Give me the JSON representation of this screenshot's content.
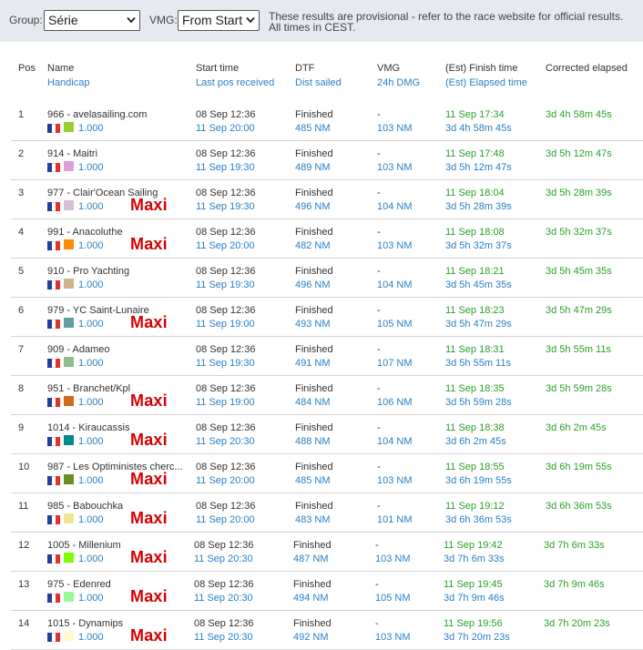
{
  "toolbar": {
    "group_label": "Group:",
    "group_value": "Série",
    "vmg_label": "VMG:",
    "vmg_value": "From Start",
    "notice_line1": "These results are provisional - refer to the race website for official results.",
    "notice_line2": "All times in CEST."
  },
  "headers": {
    "pos": "Pos",
    "name": "Name",
    "handicap": "Handicap",
    "start_time": "Start time",
    "last_pos": "Last pos received",
    "dtf": "DTF",
    "dist_sailed": "Dist sailed",
    "vmg": "VMG",
    "dmg": "24h DMG",
    "finish_time": "(Est) Finish time",
    "elapsed_time": "(Est) Elapsed time",
    "corrected": "Corrected elapsed"
  },
  "annotation_label": "Maxi",
  "rows": [
    {
      "pos": "1",
      "name": "966 - avelasailing.com",
      "handicap": "1.000",
      "swatch": "#9acd32",
      "start": "08 Sep 12:36",
      "last_pos": "11 Sep 20:00",
      "dtf": "Finished",
      "dist": "485 NM",
      "vmg": "-",
      "dmg": "103 NM",
      "finish": "11 Sep 17:34",
      "elapsed": "3d 4h 58m 45s",
      "corrected": "3d 4h 58m 45s",
      "maxi": false
    },
    {
      "pos": "2",
      "name": "914 - Maitri",
      "handicap": "1.000",
      "swatch": "#dda0dd",
      "start": "08 Sep 12:36",
      "last_pos": "11 Sep 19:30",
      "dtf": "Finished",
      "dist": "489 NM",
      "vmg": "-",
      "dmg": "103 NM",
      "finish": "11 Sep 17:48",
      "elapsed": "3d 5h 12m 47s",
      "corrected": "3d 5h 12m 47s",
      "maxi": false
    },
    {
      "pos": "3",
      "name": "977 - Clair'Ocean Sailing",
      "handicap": "1.000",
      "swatch": "#d8bfd8",
      "start": "08 Sep 12:36",
      "last_pos": "11 Sep 19:30",
      "dtf": "Finished",
      "dist": "496 NM",
      "vmg": "-",
      "dmg": "104 NM",
      "finish": "11 Sep 18:04",
      "elapsed": "3d 5h 28m 39s",
      "corrected": "3d 5h 28m 39s",
      "maxi": true
    },
    {
      "pos": "4",
      "name": "991 - Anacoluthe",
      "handicap": "1.000",
      "swatch": "#ff8c00",
      "start": "08 Sep 12:36",
      "last_pos": "11 Sep 20:00",
      "dtf": "Finished",
      "dist": "482 NM",
      "vmg": "-",
      "dmg": "103 NM",
      "finish": "11 Sep 18:08",
      "elapsed": "3d 5h 32m 37s",
      "corrected": "3d 5h 32m 37s",
      "maxi": true
    },
    {
      "pos": "5",
      "name": "910 - Pro Yachting",
      "handicap": "1.000",
      "swatch": "#d2b48c",
      "start": "08 Sep 12:36",
      "last_pos": "11 Sep 19:30",
      "dtf": "Finished",
      "dist": "496 NM",
      "vmg": "-",
      "dmg": "104 NM",
      "finish": "11 Sep 18:21",
      "elapsed": "3d 5h 45m 35s",
      "corrected": "3d 5h 45m 35s",
      "maxi": false
    },
    {
      "pos": "6",
      "name": "979 - YC Saint-Lunaire",
      "handicap": "1.000",
      "swatch": "#5f9ea0",
      "start": "08 Sep 12:36",
      "last_pos": "11 Sep 19:00",
      "dtf": "Finished",
      "dist": "493 NM",
      "vmg": "-",
      "dmg": "105 NM",
      "finish": "11 Sep 18:23",
      "elapsed": "3d 5h 47m 29s",
      "corrected": "3d 5h 47m 29s",
      "maxi": true
    },
    {
      "pos": "7",
      "name": "909 - Adameo",
      "handicap": "1.000",
      "swatch": "#8fbc8f",
      "start": "08 Sep 12:36",
      "last_pos": "11 Sep 19:30",
      "dtf": "Finished",
      "dist": "491 NM",
      "vmg": "-",
      "dmg": "107 NM",
      "finish": "11 Sep 18:31",
      "elapsed": "3d 5h 55m 11s",
      "corrected": "3d 5h 55m 11s",
      "maxi": false
    },
    {
      "pos": "8",
      "name": "951 - Branchet/Kpl",
      "handicap": "1.000",
      "swatch": "#d2691e",
      "start": "08 Sep 12:36",
      "last_pos": "11 Sep 19:00",
      "dtf": "Finished",
      "dist": "484 NM",
      "vmg": "-",
      "dmg": "106 NM",
      "finish": "11 Sep 18:35",
      "elapsed": "3d 5h 59m 28s",
      "corrected": "3d 5h 59m 28s",
      "maxi": true
    },
    {
      "pos": "9",
      "name": "1014 - Kiraucassis",
      "handicap": "1.000",
      "swatch": "#008b8b",
      "start": "08 Sep 12:36",
      "last_pos": "11 Sep 20:30",
      "dtf": "Finished",
      "dist": "488 NM",
      "vmg": "-",
      "dmg": "104 NM",
      "finish": "11 Sep 18:38",
      "elapsed": "3d 6h 2m 45s",
      "corrected": "3d 6h 2m 45s",
      "maxi": true
    },
    {
      "pos": "10",
      "name": "987 - Les Optiministes cherc...",
      "handicap": "1.000",
      "swatch": "#6b8e23",
      "start": "08 Sep 12:36",
      "last_pos": "11 Sep 20:00",
      "dtf": "Finished",
      "dist": "485 NM",
      "vmg": "-",
      "dmg": "103 NM",
      "finish": "11 Sep 18:55",
      "elapsed": "3d 6h 19m 55s",
      "corrected": "3d 6h 19m 55s",
      "maxi": true
    },
    {
      "pos": "11",
      "name": "985 - Babouchka",
      "handicap": "1.000",
      "swatch": "#f0e68c",
      "start": "08 Sep 12:36",
      "last_pos": "11 Sep 20:00",
      "dtf": "Finished",
      "dist": "483 NM",
      "vmg": "-",
      "dmg": "101 NM",
      "finish": "11 Sep 19:12",
      "elapsed": "3d 6h 36m 53s",
      "corrected": "3d 6h 36m 53s",
      "maxi": true
    },
    {
      "pos": "12",
      "name": "1005 - Millenium",
      "handicap": "1.000",
      "swatch": "#7cfc00",
      "start": "08 Sep 12:36",
      "last_pos": "11 Sep 20:30",
      "dtf": "Finished",
      "dist": "487 NM",
      "vmg": "-",
      "dmg": "103 NM",
      "finish": "11 Sep 19:42",
      "elapsed": "3d 7h 6m 33s",
      "corrected": "3d 7h 6m 33s",
      "maxi": true
    },
    {
      "pos": "13",
      "name": "975 - Edenred",
      "handicap": "1.000",
      "swatch": "#98fb98",
      "start": "08 Sep 12:36",
      "last_pos": "11 Sep 20:30",
      "dtf": "Finished",
      "dist": "494 NM",
      "vmg": "-",
      "dmg": "105 NM",
      "finish": "11 Sep 19:45",
      "elapsed": "3d 7h 9m 46s",
      "corrected": "3d 7h 9m 46s",
      "maxi": true
    },
    {
      "pos": "14",
      "name": "1015 - Dynamips",
      "handicap": "1.000",
      "swatch": "#fffacd",
      "start": "08 Sep 12:36",
      "last_pos": "11 Sep 20:30",
      "dtf": "Finished",
      "dist": "492 NM",
      "vmg": "-",
      "dmg": "103 NM",
      "finish": "11 Sep 19:56",
      "elapsed": "3d 7h 20m 23s",
      "corrected": "3d 7h 20m 23s",
      "maxi": true
    }
  ]
}
